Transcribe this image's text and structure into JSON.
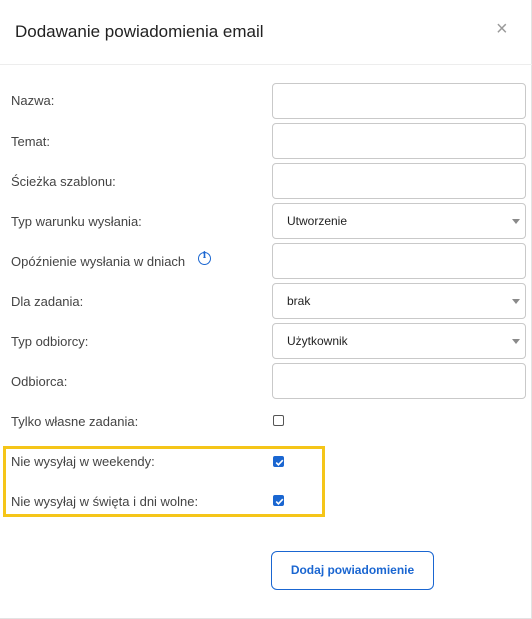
{
  "dialog": {
    "title": "Dodawanie powiadomienia email",
    "close_symbol": "×"
  },
  "form": {
    "name_label": "Nazwa:",
    "subject_label": "Temat:",
    "template_path_label": "Ścieżka szablonu:",
    "send_condition_label": "Typ warunku wysłania:",
    "send_condition_value": "Utworzenie",
    "delay_label": "Opóźnienie wysłania w dniach",
    "delay_info_icon": "info-circle-icon",
    "for_task_label": "Dla zadania:",
    "for_task_value": "brak",
    "recipient_type_label": "Typ odbiorcy:",
    "recipient_type_value": "Użytkownik",
    "recipient_label": "Odbiorca:",
    "own_tasks_label": "Tylko własne zadania:",
    "own_tasks_checked": false,
    "no_weekends_label": "Nie wysyłaj w weekendy:",
    "no_weekends_checked": true,
    "no_holidays_label": "Nie wysyłaj w święta i dni wolne:",
    "no_holidays_checked": true,
    "submit_label": "Dodaj powiadomienie"
  },
  "colors": {
    "accent": "#1a66d1",
    "highlight": "#f5c518"
  }
}
